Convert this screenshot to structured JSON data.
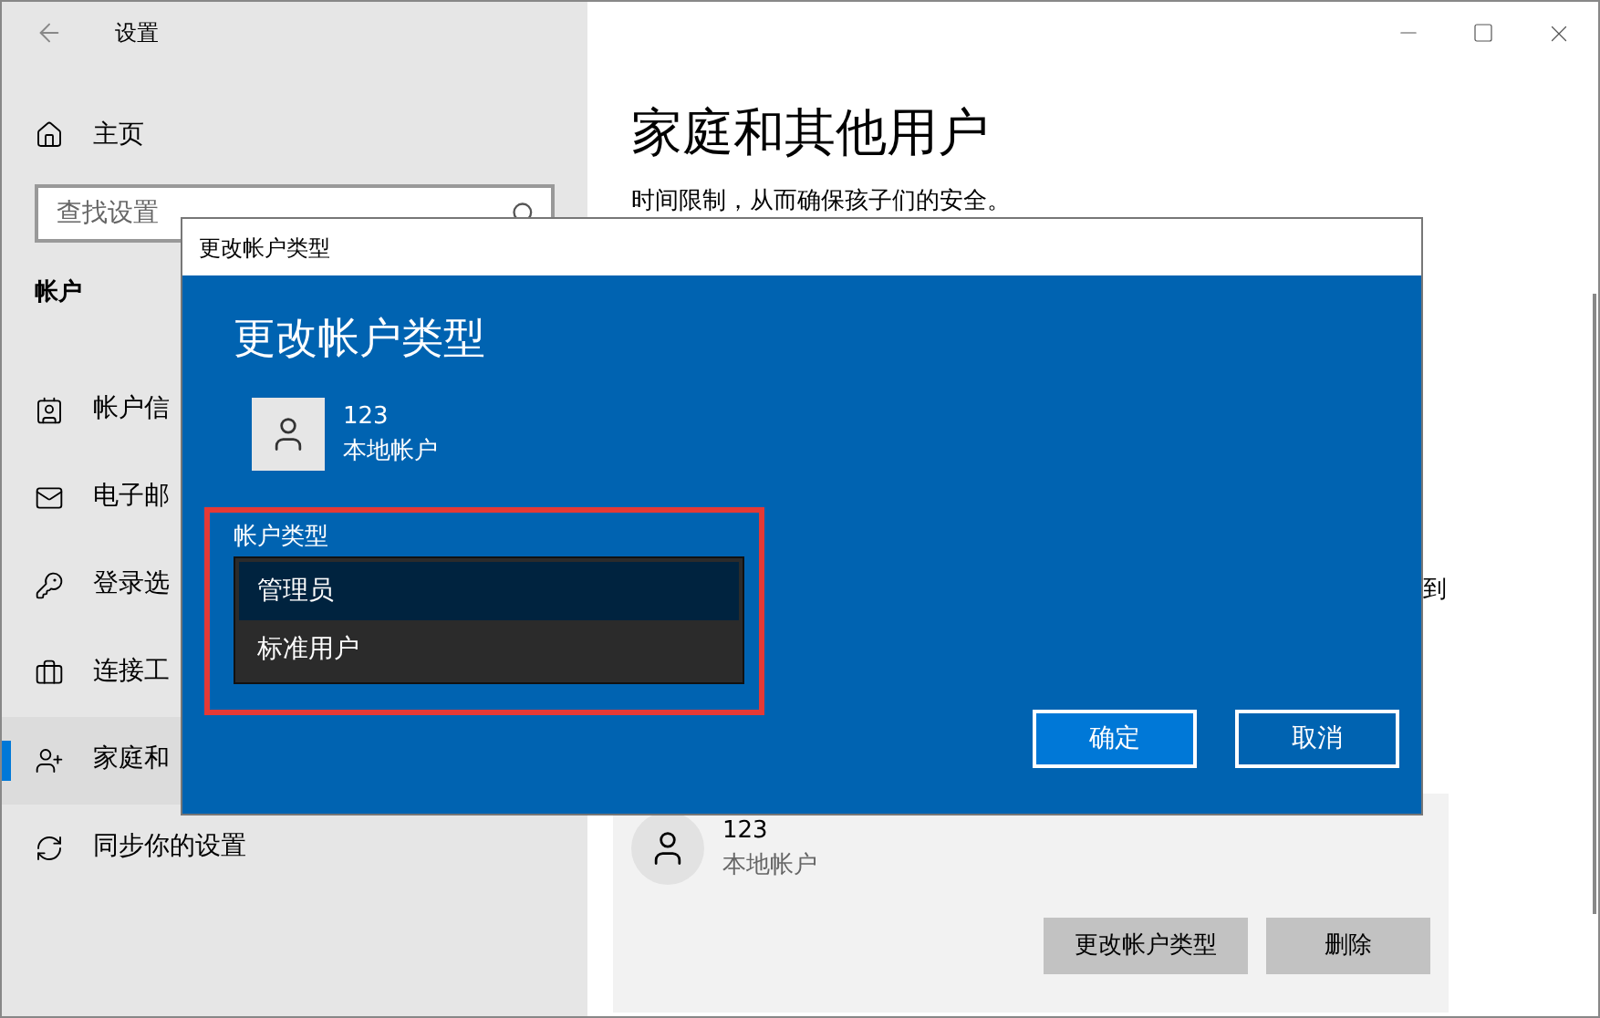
{
  "window": {
    "title": "设置"
  },
  "sidebar": {
    "home": "主页",
    "search": {
      "placeholder": "查找设置"
    },
    "section": "帐户",
    "items": [
      {
        "label": "帐户信",
        "selected": false
      },
      {
        "label": "电子邮",
        "selected": false
      },
      {
        "label": "登录选",
        "selected": false
      },
      {
        "label": "连接工",
        "selected": false
      },
      {
        "label": "家庭和",
        "selected": true
      },
      {
        "label": "同步你的设置",
        "selected": false
      }
    ]
  },
  "content": {
    "heading": "家庭和其他用户",
    "description": "时间限制，从而确保孩子们的安全。",
    "side_text": "到",
    "user_card": {
      "name": "123",
      "type": "本地帐户",
      "buttons": [
        "更改帐户类型",
        "删除"
      ]
    }
  },
  "dialog": {
    "title": "更改帐户类型",
    "heading": "更改帐户类型",
    "user": {
      "name": "123",
      "type": "本地帐户"
    },
    "field_label": "帐户类型",
    "options": [
      {
        "label": "管理员",
        "selected": true
      },
      {
        "label": "标准用户",
        "selected": false
      }
    ],
    "buttons": [
      {
        "label": "确定",
        "kind": "primary"
      },
      {
        "label": "取消",
        "kind": "secondary"
      }
    ]
  }
}
